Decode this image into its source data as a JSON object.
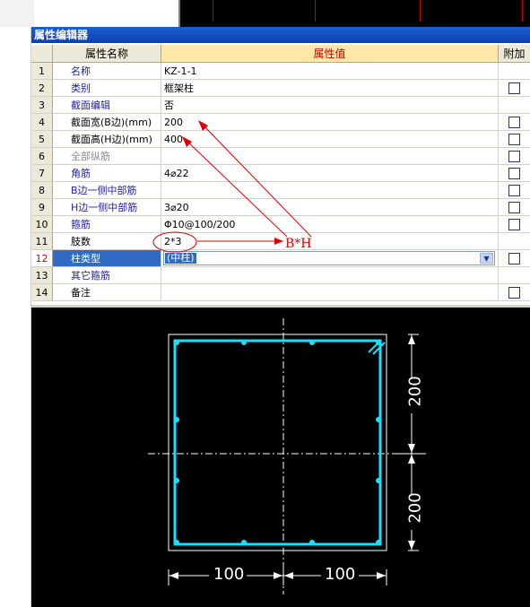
{
  "window": {
    "title": "属性编辑器"
  },
  "table": {
    "headers": {
      "name": "属性名称",
      "value": "属性值",
      "extra": "附加"
    },
    "rows": [
      {
        "num": "1",
        "name": "名称",
        "value": "KZ-1-1",
        "checkbox": false,
        "color": "blue"
      },
      {
        "num": "2",
        "name": "类别",
        "value": "框架柱",
        "checkbox": true,
        "color": "blue"
      },
      {
        "num": "3",
        "name": "截面编辑",
        "value": "否",
        "checkbox": false,
        "color": "blue"
      },
      {
        "num": "4",
        "name": "截面宽(B边)(mm)",
        "value": "200",
        "checkbox": true,
        "color": "black"
      },
      {
        "num": "5",
        "name": "截面高(H边)(mm)",
        "value": "400",
        "checkbox": true,
        "color": "black"
      },
      {
        "num": "6",
        "name": "全部纵筋",
        "value": "",
        "checkbox": true,
        "color": "gray"
      },
      {
        "num": "7",
        "name": "角筋",
        "value": "4⌀22",
        "checkbox": true,
        "color": "blue"
      },
      {
        "num": "8",
        "name": "B边一侧中部筋",
        "value": "",
        "checkbox": true,
        "color": "blue"
      },
      {
        "num": "9",
        "name": "H边一侧中部筋",
        "value": "3⌀20",
        "checkbox": true,
        "color": "blue"
      },
      {
        "num": "10",
        "name": "箍筋",
        "value": "Φ10@100/200",
        "checkbox": true,
        "color": "blue"
      },
      {
        "num": "11",
        "name": "肢数",
        "value": "2*3",
        "checkbox": false,
        "color": "black"
      },
      {
        "num": "12",
        "name": "柱类型",
        "value": "(中柱)",
        "checkbox": true,
        "color": "blue",
        "selected": true
      },
      {
        "num": "13",
        "name": "其它箍筋",
        "value": "",
        "checkbox": false,
        "color": "blue"
      },
      {
        "num": "14",
        "name": "备注",
        "value": "",
        "checkbox": true,
        "color": "black"
      }
    ]
  },
  "annotation": {
    "text": "B*H",
    "color": "#e00000"
  },
  "drawing": {
    "dim_right_top": "200",
    "dim_right_bottom": "200",
    "dim_bottom_left": "100",
    "dim_bottom_right": "100",
    "rebar_color": "#19e0ff"
  }
}
